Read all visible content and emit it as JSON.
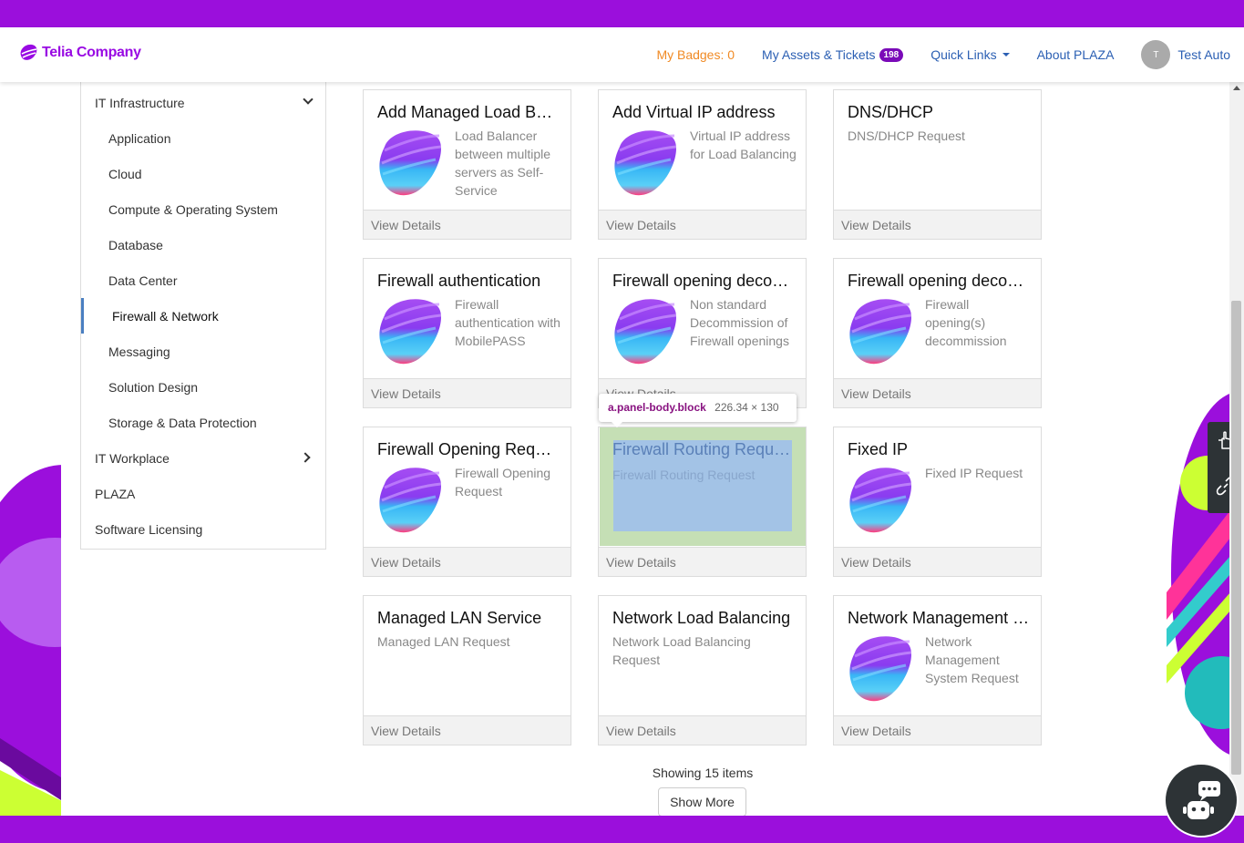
{
  "brand": {
    "name": "Telia Company",
    "color": "#990ae3"
  },
  "nav": {
    "badges": "My Badges: 0",
    "assets": "My Assets & Tickets",
    "assets_count": "198",
    "quick_links": "Quick Links",
    "about": "About PLAZA",
    "avatar_initial": "T",
    "user_name": "Test Auto"
  },
  "sidebar": {
    "items": [
      {
        "label": "IT Infrastructure"
      },
      {
        "label": "Application"
      },
      {
        "label": "Cloud"
      },
      {
        "label": "Compute & Operating System"
      },
      {
        "label": "Database"
      },
      {
        "label": "Data Center"
      },
      {
        "label": "Firewall & Network"
      },
      {
        "label": "Messaging"
      },
      {
        "label": "Solution Design"
      },
      {
        "label": "Storage & Data Protection"
      },
      {
        "label": "IT Workplace"
      },
      {
        "label": "PLAZA"
      },
      {
        "label": "Software Licensing"
      }
    ]
  },
  "cards": [
    {
      "title": "Add Managed Load Balancer",
      "desc": "Load Balancer between multiple servers as Self-Service",
      "footer": "View Details"
    },
    {
      "title": "Add Virtual IP address",
      "desc": "Virtual IP address for Load Balancing",
      "footer": "View Details"
    },
    {
      "title": "DNS/DHCP",
      "desc": "DNS/DHCP Request",
      "footer": "View Details"
    },
    {
      "title": "Firewall authentication",
      "desc": "Firewall authentication with MobilePASS",
      "footer": "View Details"
    },
    {
      "title": "Firewall opening decommission",
      "desc": "Non standard Decommission of Firewall openings",
      "footer": "View Details"
    },
    {
      "title": "Firewall opening decommission",
      "desc": "Firewall opening(s) decommission",
      "footer": "View Details"
    },
    {
      "title": "Firewall Opening Request",
      "desc": "Firewall Opening Request",
      "footer": "View Details"
    },
    {
      "title": "Firewall Routing Request",
      "desc": "Firewall Routing Request",
      "footer": "View Details"
    },
    {
      "title": "Fixed IP",
      "desc": "Fixed IP Request",
      "footer": "View Details"
    },
    {
      "title": "Managed LAN Service",
      "desc": "Managed LAN Request",
      "footer": "View Details"
    },
    {
      "title": "Network Load Balancing",
      "desc": "Network Load Balancing Request",
      "footer": "View Details"
    },
    {
      "title": "Network Management System",
      "desc": "Network Management System Request",
      "footer": "View Details"
    }
  ],
  "inspector_tooltip": {
    "selector": "a.panel-body.block",
    "size": "226.34 × 130"
  },
  "showing": "Showing 15 items",
  "show_more": "Show More",
  "icons": {
    "side_tool_1": "hand-pointer-icon",
    "side_tool_2": "link-icon",
    "chat": "chatbot-icon"
  }
}
